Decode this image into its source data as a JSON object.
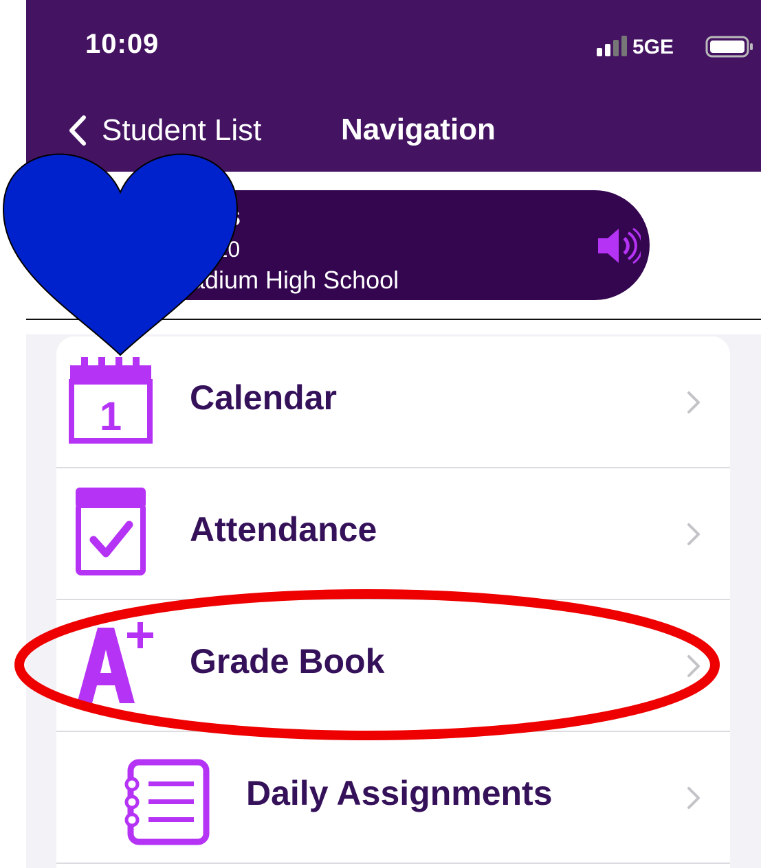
{
  "status_bar": {
    "time": "10:09",
    "network": "5GE"
  },
  "nav_bar": {
    "back_label": "Student List",
    "title": "Navigation"
  },
  "student": {
    "name": "s",
    "grade": "e: 10",
    "school": "adium High School"
  },
  "menu": {
    "items": [
      {
        "label": "Calendar",
        "icon": "calendar-icon",
        "calendar_day": "1"
      },
      {
        "label": "Attendance",
        "icon": "attendance-icon"
      },
      {
        "label": "Grade Book",
        "icon": "grade-book-icon"
      },
      {
        "label": "Daily Assignments",
        "icon": "daily-assignments-icon"
      }
    ]
  },
  "colors": {
    "header_bg": "#441462",
    "card_bg": "#33064f",
    "icon_accent": "#b533f5",
    "label_text": "#35115a",
    "annotation_heart": "#0022cc",
    "annotation_ellipse": "#ee0000"
  }
}
